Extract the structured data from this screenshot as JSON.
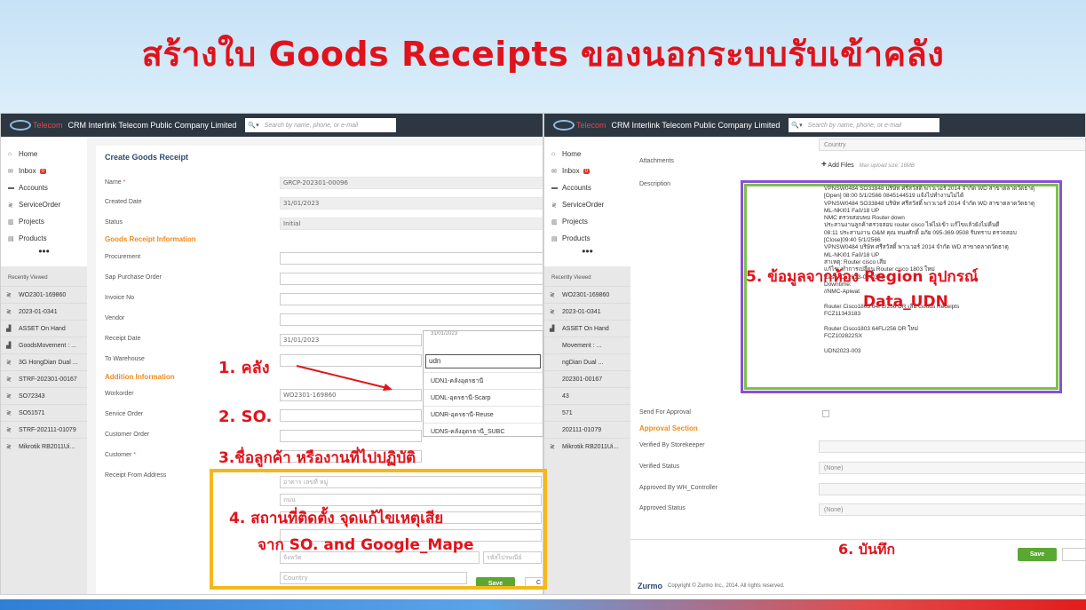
{
  "slide_title": "สร้างใบ Goods Receipts ของนอกระบบรับเข้าคลัง",
  "app": {
    "logo_text": "Telecom",
    "company": "CRM Interlink Telecom Public Company Limited",
    "search_placeholder": "Search by name, phone, or e-mail"
  },
  "nav": {
    "home": "Home",
    "inbox": "Inbox",
    "inbox_badge": "0",
    "accounts": "Accounts",
    "service_order": "ServiceOrder",
    "projects": "Projects",
    "products": "Products",
    "more": "•••"
  },
  "recent": {
    "title": "Recently Viewed",
    "items_left": [
      "WO2301-169860",
      "2023-01-0341",
      "ASSET On Hand",
      "GoodsMovement : ...",
      "3G HongDian Dual ...",
      "STRF-202301-00167",
      "SO72343",
      "SO51571",
      "STRF-202111-01079",
      "Mikrotik RB2011Ui..."
    ],
    "items_right": [
      "WO2301-169860",
      "2023-01-0341",
      "ASSET On Hand",
      "Movement : ...",
      "ngDian Dual ...",
      "202301-00167",
      "43",
      "571",
      "202111-01079",
      "Mikrotik RB2011Ui..."
    ]
  },
  "form": {
    "title": "Create Goods Receipt",
    "name_label": "Name",
    "name_value": "GRCP-202301-00096",
    "created_label": "Created Date",
    "created_value": "31/01/2023",
    "status_label": "Status",
    "status_value": "Initial",
    "section_info": "Goods Receipt Information",
    "procurement_label": "Procurement",
    "sap_label": "Sap Purchase Order",
    "invoice_label": "Invoice No",
    "vendor_label": "Vendor",
    "receipt_date_label": "Receipt Date",
    "receipt_date_value": "31/01/2023",
    "warehouse_label": "To Warehouse",
    "section_addition": "Addition Information",
    "workorder_label": "Workorder",
    "workorder_value": "WO2301-169860",
    "service_order_label": "Service Order",
    "customer_order_label": "Customer Order",
    "customer_label": "Customer",
    "address_label": "Receipt From Address",
    "addr_line1_ph": "อาคาร เลขที่ หมู่",
    "addr_line2_ph": "ถนน",
    "addr_province_ph": "จังหวัด",
    "addr_postal_ph": "รหัสไปรษณีย์",
    "addr_country_ph": "Country",
    "save_label": "Save",
    "save_partial": "C"
  },
  "warehouse_dropdown": {
    "hidden_value": "31/01/2023",
    "input_value": "udn",
    "options": [
      "UDN1-คลังอุดรธานี",
      "UDNL-อุดรธานี-Scarp",
      "UDNR-อุดรธานี-Reuse",
      "UDNS-คลังอุดรธานี_SUBC"
    ]
  },
  "right_form": {
    "country_ph": "Country",
    "attachments_label": "Attachments",
    "add_files": "Add Files",
    "max_upload": "Max upload size: 16MB",
    "description_label": "Description",
    "description_lines": [
      "VPNSW0484  SO33848 บริษัท ศรีสวัสดิ์ พาวเวอร์ 2014 จำกัด WD สาขาตลาดวัดธาตุ",
      "[Open] 08:00 5/1/2566 0845144519 แจ้งไปทำงานไม่ได้",
      "VPNSW0484  SO33848 บริษัท ศรีสวัสดิ์ พาวเวอร์ 2014 จำกัด WD สาขาตลาดวัดธาตุ",
      "ML-NKI01 Fa0/18 UP",
      "NMC ตรวจสอบพบ Router down",
      "ประสานงานลูกค้าตรวจสอบ router cisco ไฟไม่เข้า แก้ไขแล้วยังไม่คืนดี",
      "08:11 ประสานงาน O&M คุณ ทนงศักดิ์ อภัย 095-369-9508 รับทราบ  ตรวจสอบ",
      "[Close]09:40 5/1/2566",
      "VPNSW0484 บริษัท ศรีสวัสดิ์ พาวเวอร์ 2014 จำกัด WD สาขาตลาดวัดธาตุ",
      "ML-NKI01 Fa0/18 UP",
      "สาเหตุ: Router cisco เสีย",
      "แก้ไข: ทำการเปลี่ยน Router cisco 1803 ใหม่",
      "Case ID: 2023-01-0341",
      "Downtime:",
      "//NMC-Apiwat",
      "",
      "Router Cisco1803 64FL/256 DR  เสีย  Goods Receipts",
      "FCZ11343183",
      "",
      "Router Cisco1803 64FL/256 DR  ใหม่",
      "FCZ102822SX",
      "",
      "UDN2023-003"
    ],
    "send_approval_label": "Send For Approval",
    "approval_section": "Approval Section",
    "verified_by_label": "Verified By Storekeeper",
    "verified_status_label": "Verified Status",
    "verified_status_value": "(None)",
    "approved_by_label": "Approved By WH_Controller",
    "approved_status_label": "Approved Status",
    "approved_status_value": "(None)",
    "save_label": "Save",
    "footer_brand": "Zurmo",
    "footer_copy": "Copyright © Zurmo Inc., 2014. All rights reserved."
  },
  "annotations": {
    "a1": "1. คลัง",
    "a2": "2. SO.",
    "a3": "3.ชื่อลูกค้า หรืองานที่ไปปฏิบัติ",
    "a4_line1": "4. สถานที่ติดตั้ง จุดแก้ไขเหตุเสีย",
    "a4_line2": "จาก SO. and Google_Mape",
    "a5_line1": "5. ข้อมูลจากห้อง Region อุปกรณ์",
    "a5_line2": "Data_UDN",
    "a6": "6. บันทึก"
  },
  "colors": {
    "annotation_red": "#e0131c",
    "orange_box": "#f5b81b",
    "purple_box": "#8a4fd8",
    "green_box": "#7cc04a",
    "save_green": "#5aa832"
  }
}
